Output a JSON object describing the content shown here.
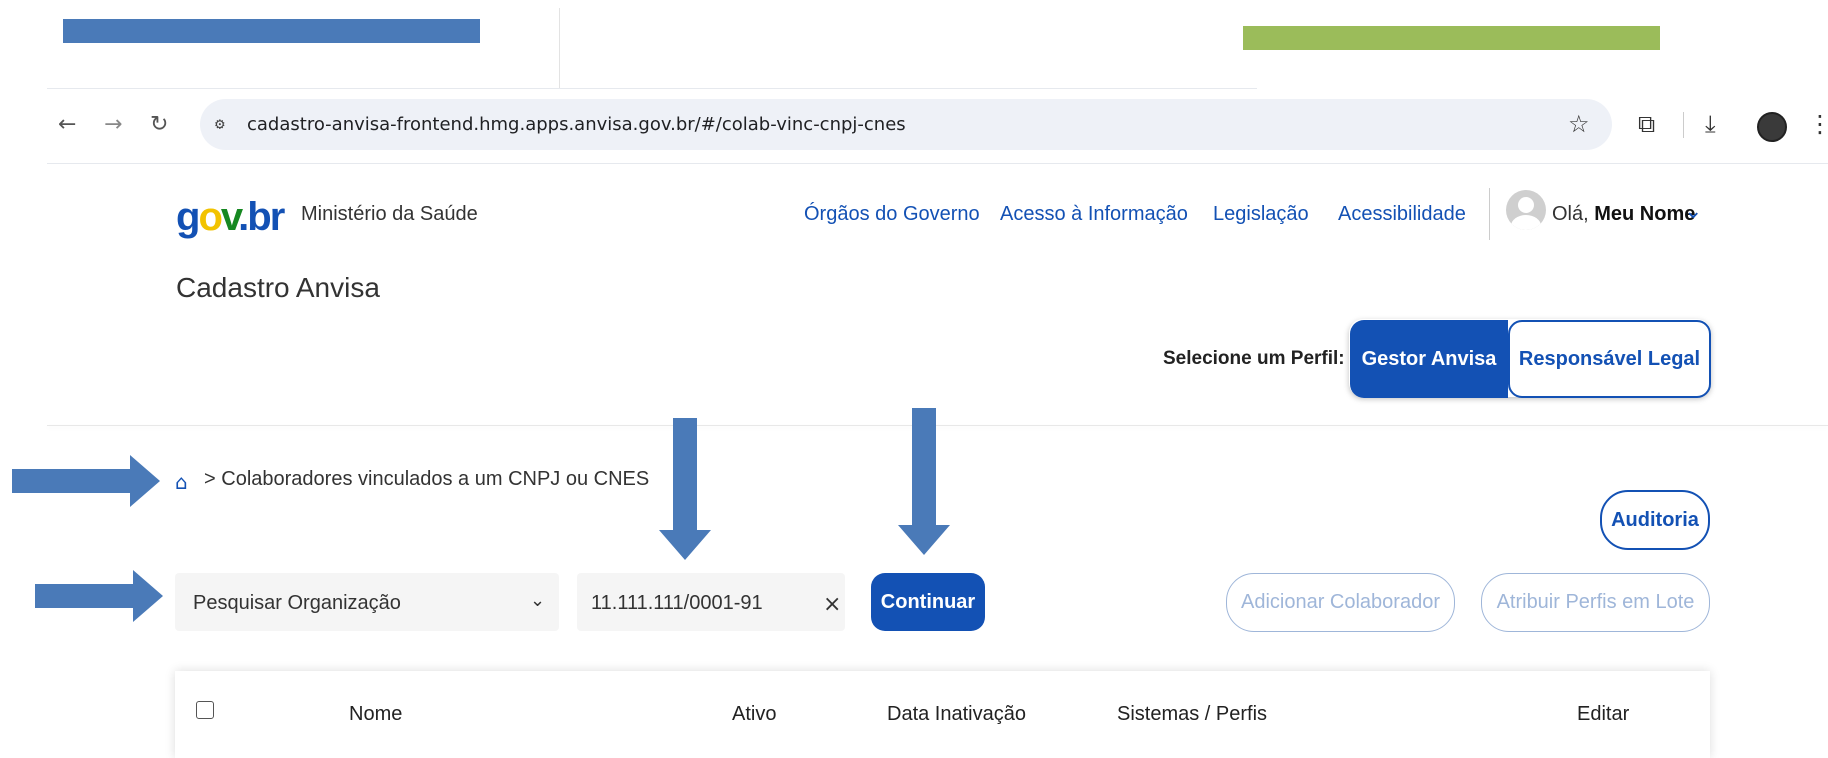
{
  "browser": {
    "url": "cadastro-anvisa-frontend.hmg.apps.anvisa.gov.br/#/colab-vinc-cnpj-cnes",
    "icons": [
      "back-arrow-icon",
      "forward-arrow-icon",
      "reload-icon",
      "site-settings-icon",
      "star-icon",
      "extensions-icon",
      "download-icon",
      "profile-avatar-icon",
      "kebab-menu-icon"
    ]
  },
  "header": {
    "logo": {
      "g": "g",
      "o": "o",
      "v": "v",
      "dot": ".",
      "br": "br"
    },
    "ministry": "Ministério da Saúde",
    "links": [
      "Órgãos do Governo",
      "Acesso à Informação",
      "Legislação",
      "Acessibilidade"
    ],
    "greeting_prefix": "Olá,",
    "user_name": "Meu Nome",
    "app_title": "Cadastro Anvisa"
  },
  "perfil": {
    "label": "Selecione um Perfil:",
    "options": [
      "Gestor Anvisa",
      "Responsável Legal"
    ],
    "selected": "Gestor Anvisa"
  },
  "breadcrumb": {
    "separator": ">",
    "current": "Colaboradores vinculados a um CNPJ ou CNES"
  },
  "actions": {
    "auditoria": "Auditoria",
    "adicionar": "Adicionar Colaborador",
    "atribuir": "Atribuir Perfis em Lote"
  },
  "search": {
    "select_value": "Pesquisar Organização",
    "input_value": "11.111.111/0001-91",
    "clear": "×",
    "continue": "Continuar"
  },
  "table": {
    "columns": [
      "Nome",
      "Ativo",
      "Data Inativação",
      "Sistemas / Perfis",
      "Editar"
    ]
  },
  "colors": {
    "primary": "#1351b4",
    "annotation_arrow": "#4a7ab8",
    "bar_blue": "#4a7ab8",
    "bar_green": "#9bbc5a"
  }
}
